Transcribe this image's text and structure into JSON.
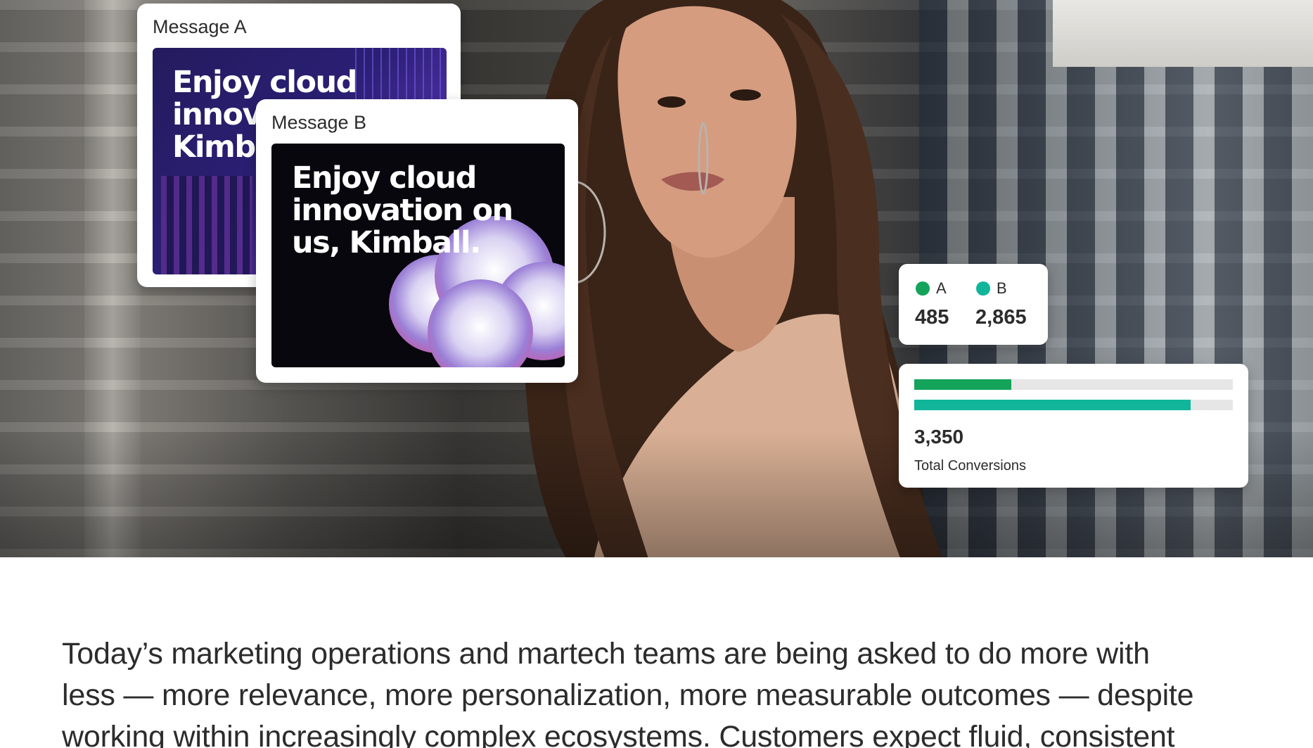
{
  "message_a": {
    "label": "Message A",
    "headline_lines": [
      "Enjoy cloud",
      "innova",
      "Kimba"
    ]
  },
  "message_b": {
    "label": "Message B",
    "headline_lines": [
      "Enjoy cloud",
      "innovation on",
      "us, Kimball."
    ]
  },
  "stats": {
    "a_label": "A",
    "b_label": "B",
    "a_value": "485",
    "b_value": "2,865",
    "a_color": "#13a35a",
    "b_color": "#10b59a"
  },
  "conversions": {
    "a_fraction": 0.305,
    "b_fraction": 0.868,
    "a_color": "#13a35a",
    "b_color": "#10b59a",
    "total": "3,350",
    "label": "Total Conversions"
  },
  "body": {
    "lines": [
      "Today’s marketing operations and martech teams are being asked to do more with",
      "less — more relevance, more personalization, more measurable outcomes — despite",
      "working within increasingly complex ecosystems. Customers expect fluid, consistent"
    ]
  }
}
